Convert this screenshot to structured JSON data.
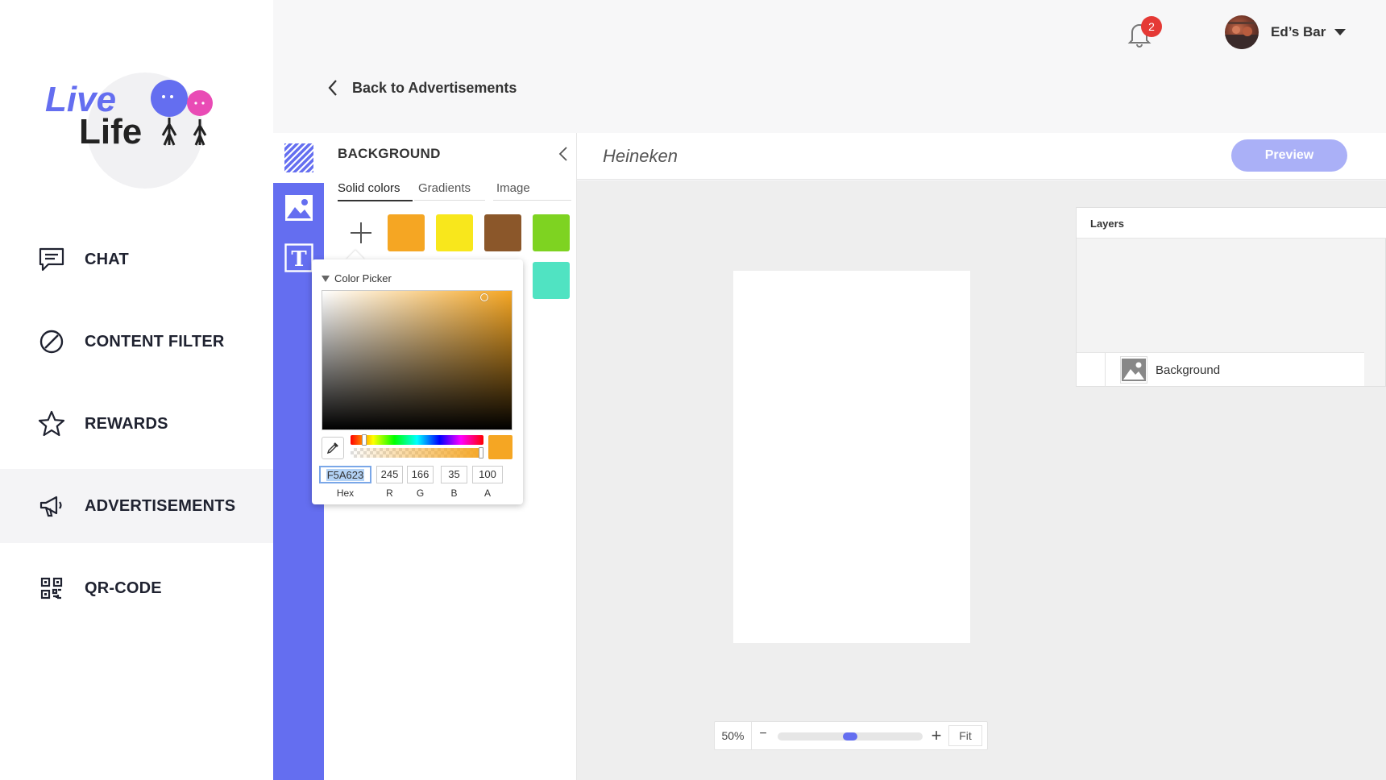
{
  "brand": {
    "line1": "Live",
    "line2": "Life"
  },
  "nav": {
    "items": [
      {
        "label": "CHAT",
        "icon": "chat-icon"
      },
      {
        "label": "CONTENT FILTER",
        "icon": "block-icon"
      },
      {
        "label": "REWARDS",
        "icon": "star-icon"
      },
      {
        "label": "ADVERTISEMENTS",
        "icon": "megaphone-icon",
        "active": true
      },
      {
        "label": "QR-CODE",
        "icon": "qr-code-icon"
      }
    ]
  },
  "topbar": {
    "notification_count": "2",
    "user_name": "Ed’s Bar"
  },
  "back_link": {
    "label": "Back to Advertisements"
  },
  "background_panel": {
    "title": "BACKGROUND",
    "tabs": [
      {
        "label": "Solid colors",
        "active": true
      },
      {
        "label": "Gradients"
      },
      {
        "label": "Image"
      }
    ],
    "swatches": [
      "#f5a623",
      "#f8e71c",
      "#8b572a",
      "#7ed321",
      "#50e3c2"
    ]
  },
  "color_picker": {
    "title": "Color Picker",
    "hex": "F5A623",
    "r": "245",
    "g": "166",
    "b": "35",
    "a": "100",
    "labels": {
      "hex": "Hex",
      "r": "R",
      "g": "G",
      "b": "B",
      "a": "A"
    },
    "hue_position": 0.1,
    "alpha_position": 1.0
  },
  "editor": {
    "doc_title": "Heineken",
    "preview_label": "Preview"
  },
  "layers": {
    "title": "Layers",
    "items": [
      {
        "name": "Background"
      }
    ]
  },
  "zoom": {
    "percent": "50%",
    "minus": "−",
    "plus": "+",
    "fit": "Fit",
    "level": 0.5
  },
  "colors": {
    "accent": "#646ef0",
    "preview_button": "#aab0f7",
    "badge": "#e53935"
  }
}
